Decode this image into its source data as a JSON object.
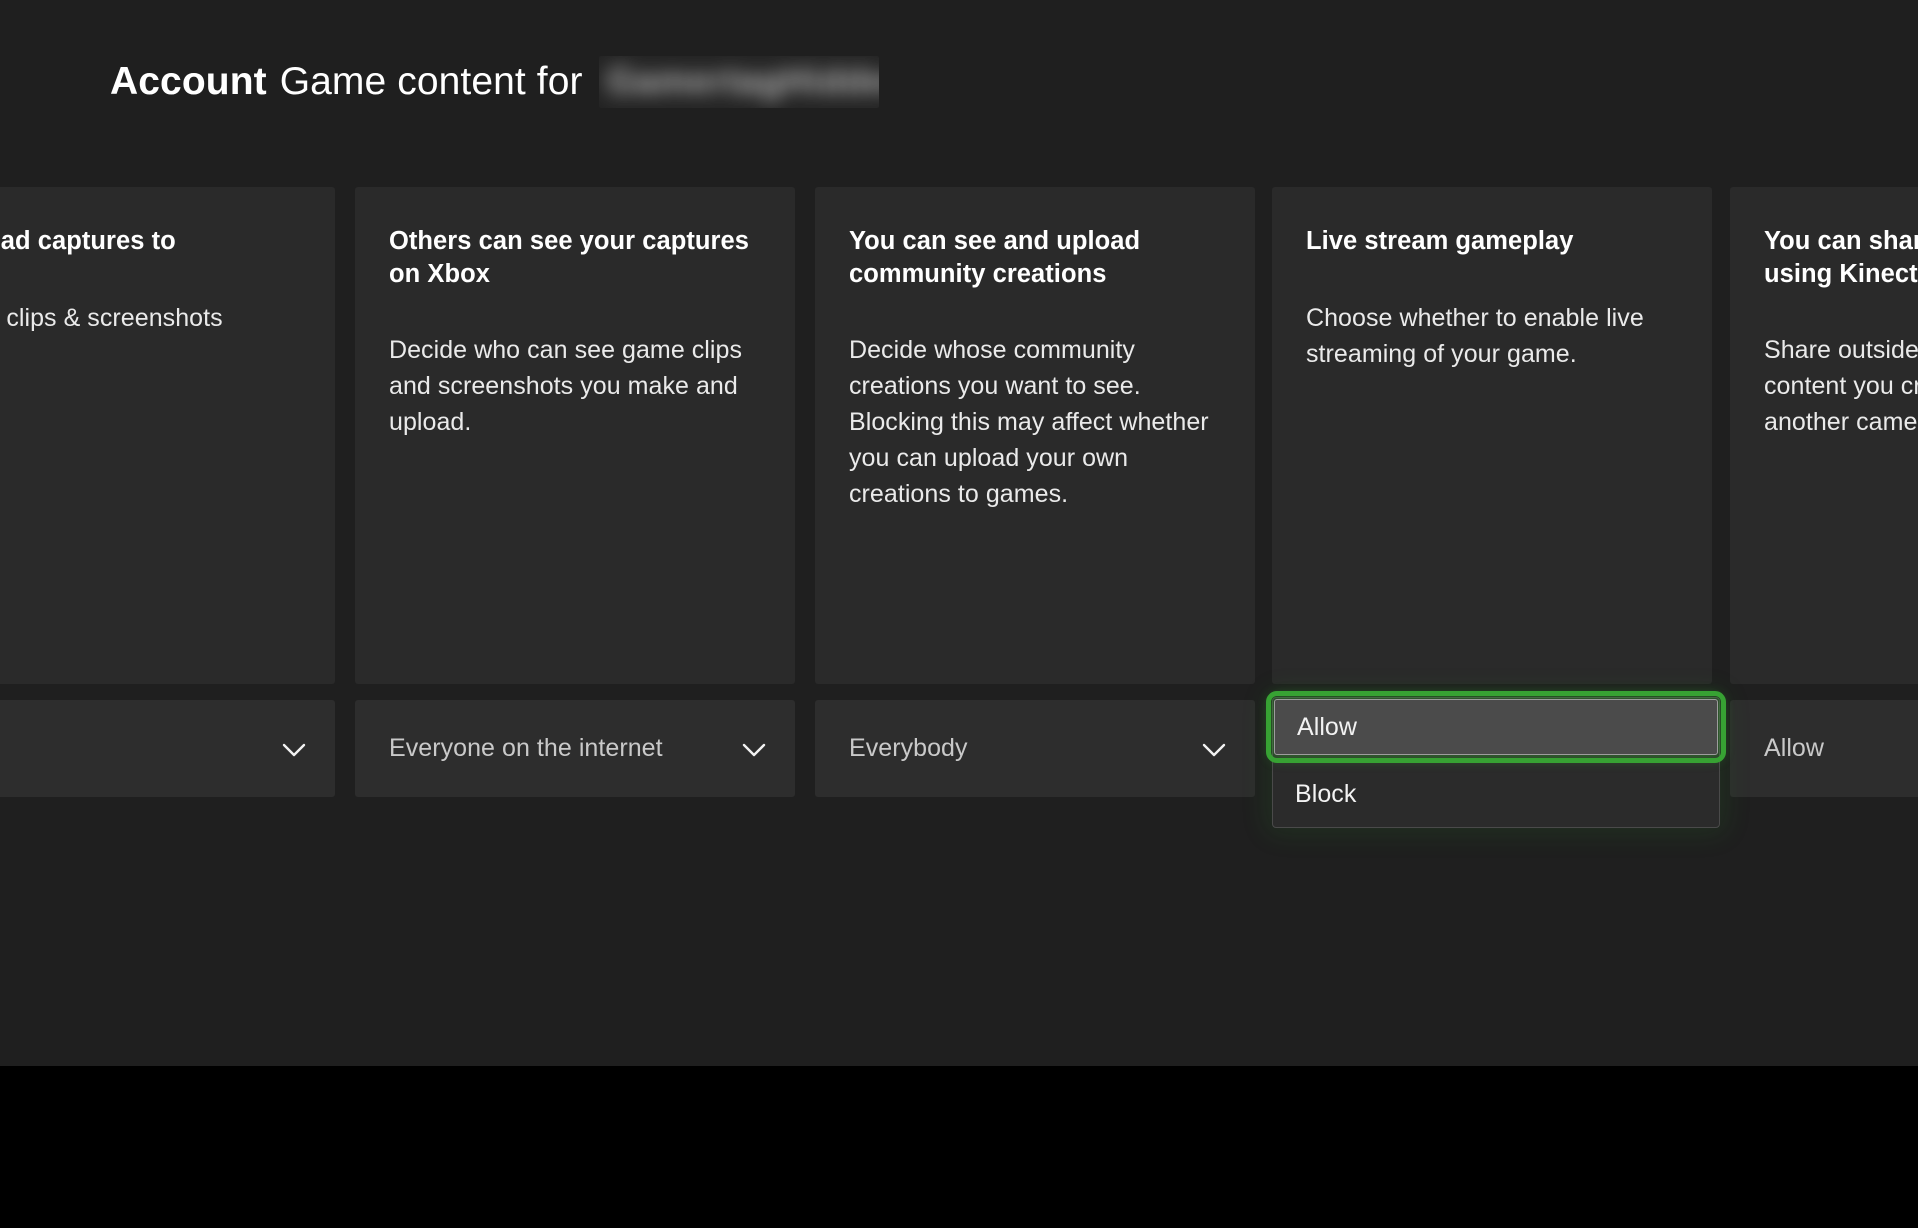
{
  "header": {
    "title_bold": "Account",
    "title_rest": "Game content for",
    "gamertag_redacted": "GamertagHidden",
    "gamertag_state": "blurred"
  },
  "colors": {
    "page_background": "#1f1f1f",
    "card_background": "#2a2a2a",
    "selector_background": "#2d2d2d",
    "focus_green": "#37a233",
    "selected_option_background": "#4b4b4b",
    "text_primary": "#ffffff",
    "text_secondary": "#c9c9c9",
    "bottom_strip": "#000000"
  },
  "cards": [
    {
      "title": "n upload captures to",
      "description": "l game clips & screenshots\nx.",
      "clipped": "left",
      "selector": {
        "value": "",
        "icon": "chevron-down-icon",
        "state": "collapsed"
      }
    },
    {
      "title": "Others can see your captures\non Xbox",
      "description": "Decide who can see game clips\nand screenshots you make and\nupload.",
      "clipped": "none",
      "selector": {
        "value": "Everyone on the internet",
        "icon": "chevron-down-icon",
        "state": "collapsed"
      }
    },
    {
      "title": "You can see and upload\ncommunity creations",
      "description": "Decide whose community\ncreations you want to see.\nBlocking this may affect whether\nyou can upload your own\ncreations to games.",
      "clipped": "none",
      "selector": {
        "value": "Everybody",
        "icon": "chevron-down-icon",
        "state": "collapsed"
      }
    },
    {
      "title": "Live stream gameplay",
      "description": "Choose whether to enable live\nstreaming of your game.",
      "clipped": "none",
      "selector": {
        "value": "Allow",
        "icon": "chevron-down-icon",
        "state": "expanded"
      }
    },
    {
      "title": "You can share\nusing Kinect o",
      "description": "Share outside\ncontent you cr\nanother camer",
      "clipped": "right",
      "selector": {
        "value": "Allow",
        "icon": "chevron-down-icon",
        "state": "collapsed"
      }
    }
  ],
  "open_dropdown": {
    "owner_card_title": "Live stream gameplay",
    "options": [
      {
        "label": "Allow",
        "selected": true
      },
      {
        "label": "Block",
        "selected": false
      }
    ]
  }
}
